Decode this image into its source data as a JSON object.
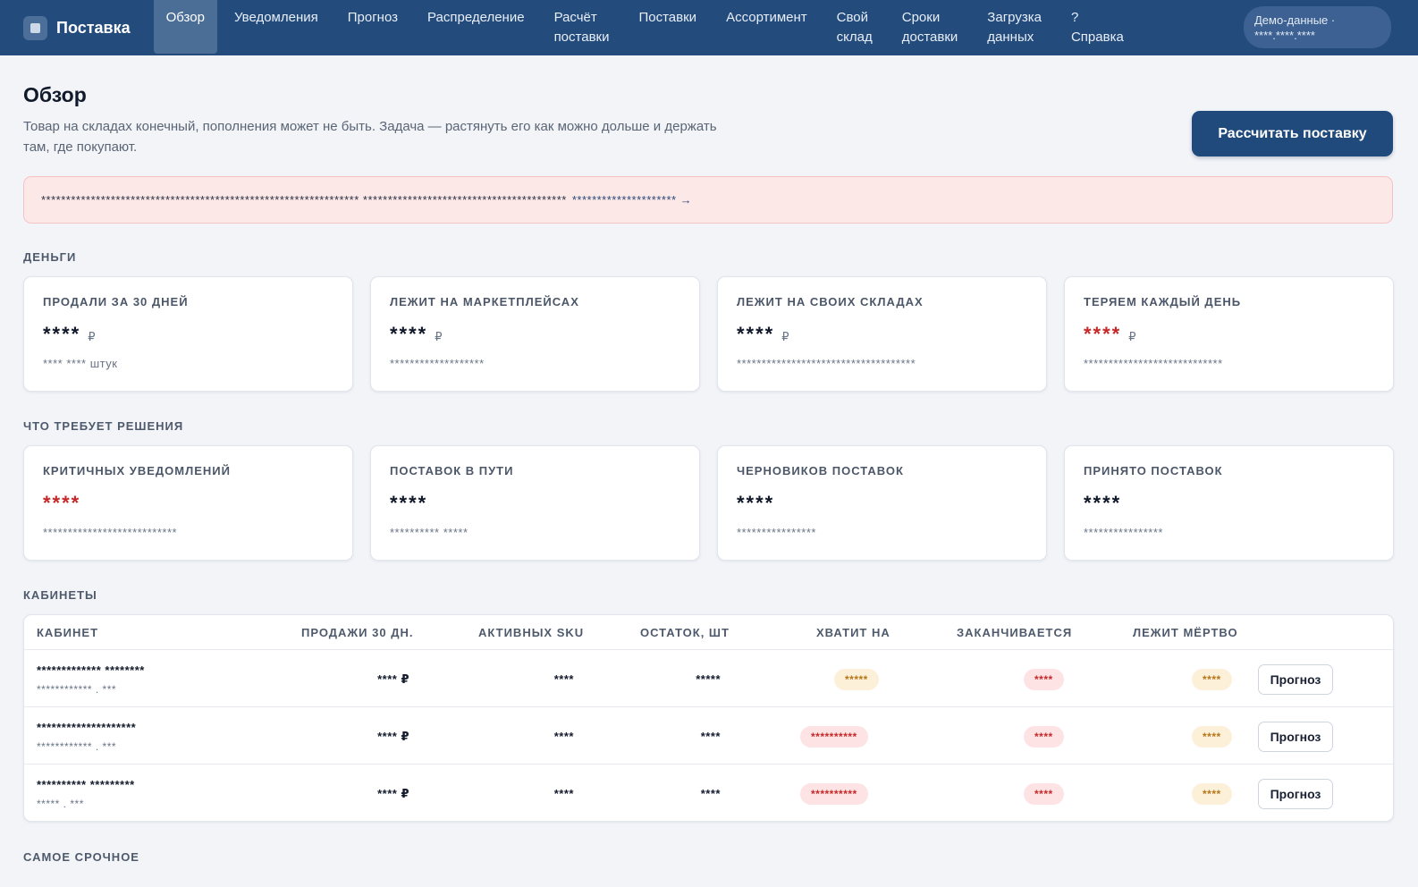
{
  "nav": {
    "brand": "Поставка",
    "items": [
      {
        "label": "Обзор",
        "active": true
      },
      {
        "label": "Уведомления"
      },
      {
        "label": "Прогноз"
      },
      {
        "label": "Распределение"
      },
      {
        "label": "Расчёт поставки",
        "lines": [
          "Расчёт",
          "поставки"
        ]
      },
      {
        "label": "Поставки"
      },
      {
        "label": "Ассортимент"
      },
      {
        "label": "Свой склад",
        "lines": [
          "Свой",
          "склад"
        ]
      },
      {
        "label": "Сроки доставки",
        "lines": [
          "Сроки",
          "доставки"
        ]
      },
      {
        "label": "Загрузка данных",
        "lines": [
          "Загрузка",
          "данных"
        ]
      },
      {
        "label": "? Справка",
        "lines": [
          "?",
          "Справка"
        ]
      }
    ],
    "demo": {
      "line1": "Демо-данные ·",
      "line2": "****.****.****"
    }
  },
  "header": {
    "title": "Обзор",
    "description": "Товар на складах конечный, пополнения может не быть. Задача — растянуть его как можно дольше и держать там, где покупают.",
    "primary_button": "Рассчитать поставку"
  },
  "alert": {
    "text": "**************************************************************** ***************************************** ",
    "link": "********************* →"
  },
  "sections": {
    "money": "ДЕНЬГИ",
    "decisions": "ЧТО ТРЕБУЕТ РЕШЕНИЯ",
    "cabinets": "КАБИНЕТЫ",
    "urgent": "САМОЕ СРОЧНОЕ"
  },
  "money_cards": [
    {
      "label": "Продали за 30 дней",
      "value": "****",
      "unit": "₽",
      "sub": "**** **** штук",
      "color": "#0f1728"
    },
    {
      "label": "Лежит на маркетплейсах",
      "value": "****",
      "unit": "₽",
      "sub": "*******************",
      "color": "#0f1728"
    },
    {
      "label": "Лежит на своих складах",
      "value": "****",
      "unit": "₽",
      "sub": "************************************",
      "color": "#0f1728"
    },
    {
      "label": "Теряем каждый день",
      "value": "****",
      "unit": "₽",
      "sub": "****************************",
      "color": "#c62828"
    }
  ],
  "decision_cards": [
    {
      "label": "Критичных уведомлений",
      "value": "****",
      "sub": "***************************",
      "color": "#c62828"
    },
    {
      "label": "Поставок в пути",
      "value": "****",
      "sub": "********** *****",
      "color": "#0f1728"
    },
    {
      "label": "Черновиков поставок",
      "value": "****",
      "sub": "****************",
      "color": "#0f1728"
    },
    {
      "label": "Принято поставок",
      "value": "****",
      "sub": "****************",
      "color": "#0f1728"
    }
  ],
  "table": {
    "columns": [
      "КАБИНЕТ",
      "ПРОДАЖИ 30 ДН.",
      "АКТИВНЫХ SKU",
      "ОСТАТОК, ШТ",
      "ХВАТИТ НА",
      "ЗАКАНЧИВАЕТСЯ",
      "ЛЕЖИТ МЁРТВО"
    ],
    "rows": [
      {
        "name": "************* ********",
        "id": "************ . ***",
        "sales": "**** ₽",
        "sku": "****",
        "stock": "*****",
        "enough": "*****",
        "enough_tone": "amber",
        "ending": "****",
        "dead": "****",
        "action": "Прогноз"
      },
      {
        "name": "********************",
        "id": "************ . ***",
        "sales": "**** ₽",
        "sku": "****",
        "stock": "****",
        "enough": "**********",
        "enough_tone": "red",
        "ending": "****",
        "dead": "****",
        "action": "Прогноз"
      },
      {
        "name": "********** *********",
        "id": "***** . ***",
        "sales": "**** ₽",
        "sku": "****",
        "stock": "****",
        "enough": "**********",
        "enough_tone": "red",
        "ending": "****",
        "dead": "****",
        "action": "Прогноз"
      }
    ]
  },
  "colors": {
    "nav_bg": "#234b7c",
    "primary": "#1f4a7b",
    "danger": "#c62828",
    "warning": "#b4761a"
  }
}
